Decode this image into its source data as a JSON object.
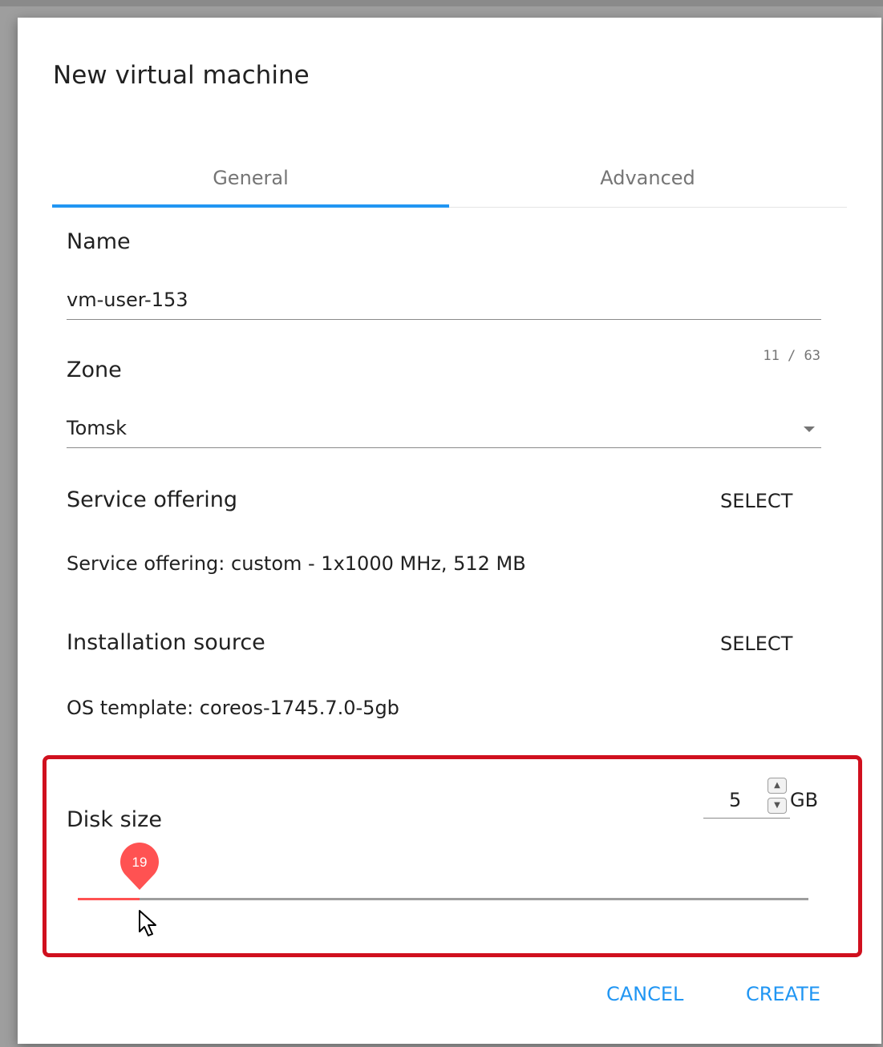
{
  "dialog": {
    "title": "New virtual machine"
  },
  "tabs": [
    {
      "label": "General",
      "active": true
    },
    {
      "label": "Advanced",
      "active": false
    }
  ],
  "name": {
    "label": "Name",
    "value": "vm-user-153",
    "counter": "11 / 63"
  },
  "zone": {
    "label": "Zone",
    "value": "Tomsk"
  },
  "service_offering": {
    "label": "Service offering",
    "select_label": "SELECT",
    "info": "Service offering: custom - 1x1000 MHz, 512 MB"
  },
  "installation_source": {
    "label": "Installation source",
    "select_label": "SELECT",
    "info": "OS template: coreos-1745.7.0-5gb"
  },
  "disk": {
    "label": "Disk size",
    "value": "5",
    "unit": "GB",
    "slider_value": "19",
    "slider_fraction": 0.085
  },
  "actions": {
    "cancel": "CANCEL",
    "create": "CREATE"
  },
  "colors": {
    "accent": "#2196f3",
    "slider": "#ff5252",
    "highlight": "#d0101e"
  },
  "icons": {
    "dropdown": "caret-down-icon",
    "spin_up": "chevron-up-icon",
    "spin_down": "chevron-down-icon",
    "cursor": "mouse-pointer-icon"
  }
}
